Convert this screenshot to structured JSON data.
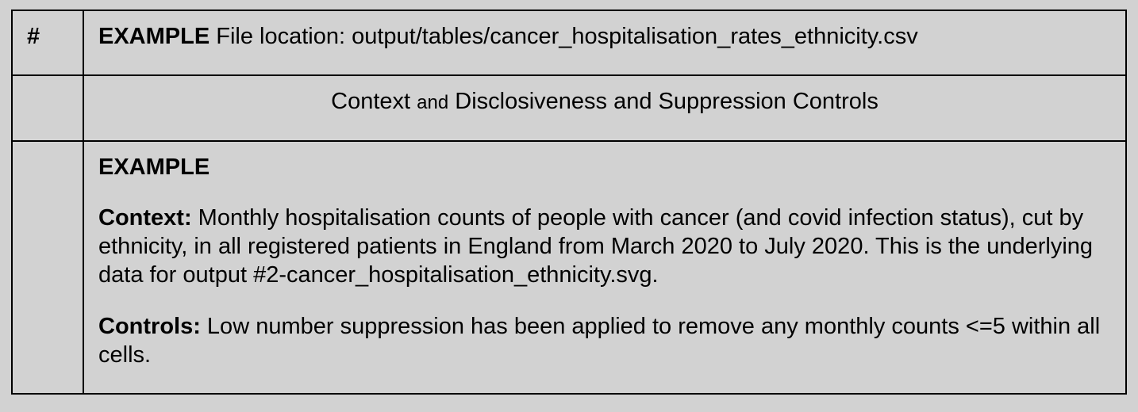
{
  "row1": {
    "hash": "#",
    "bold": "EXAMPLE",
    "rest": " File location: output/tables/cancer_hospitalisation_rates_ethnicity.csv"
  },
  "row2": {
    "title_before": "Context ",
    "title_and": "and",
    "title_after": " Disclosiveness and Suppression Controls"
  },
  "row3": {
    "example": "EXAMPLE",
    "context_label": "Context:",
    "context_text": " Monthly hospitalisation counts of people with cancer (and covid infection status), cut by ethnicity, in all registered patients in England from March 2020 to July 2020.  This is the underlying data for output #2-cancer_hospitalisation_ethnicity.svg.",
    "controls_label": "Controls:",
    "controls_text": " Low number suppression has been applied to remove any monthly counts <=5 within all cells."
  }
}
